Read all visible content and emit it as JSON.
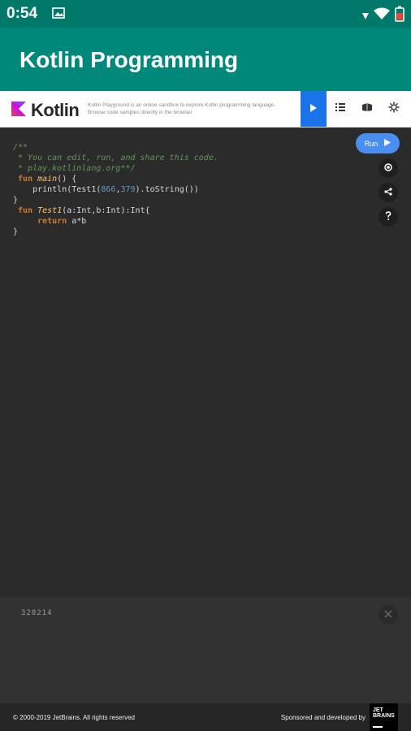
{
  "status_bar": {
    "time": "0:54"
  },
  "app_bar": {
    "title": "Kotlin Programming"
  },
  "kotlin_header": {
    "logo_text": "Kotlin",
    "description": "Kotlin Playground is an online sandbox to explore Kotlin programming language. Browse code samples directly in the browser"
  },
  "editor": {
    "lines": [
      "/**",
      " * You can edit, run, and share this code.",
      " * play.kotlinlang.org**/",
      " fun main() {",
      "    println(Test1(866,379).toString())",
      "}",
      " fun Test1(a:Int,b:Int):Int{",
      "     return a*b",
      "}"
    ],
    "run_label": "Run"
  },
  "output": {
    "text": "328214"
  },
  "footer": {
    "copyright": "© 2000-2019 JetBrains. All rights reserved",
    "sponsor": "Sponsored and developed by",
    "jetbrains_logo_text": "JET BRAINS"
  },
  "colors": {
    "status_bar": "#00796b",
    "app_bar": "#00897b",
    "run_accent": "#1a73e8",
    "editor_bg": "#2b2b2b"
  }
}
